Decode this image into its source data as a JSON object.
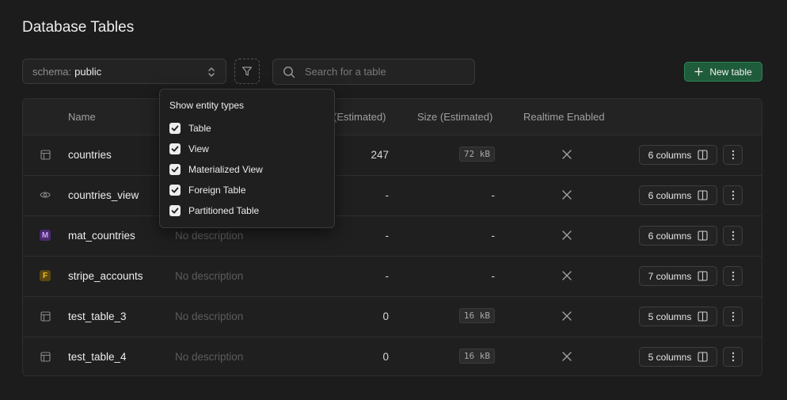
{
  "page": {
    "title": "Database Tables"
  },
  "toolbar": {
    "schema_label": "schema:",
    "schema_value": "public",
    "search_placeholder": "Search for a table",
    "new_table_label": "New table"
  },
  "table": {
    "columns": [
      "Name",
      "(Estimated)",
      "Size (Estimated)",
      "Realtime Enabled"
    ],
    "rows": [
      {
        "icon": "table-icon",
        "name": "countries",
        "description": "",
        "rows": "247",
        "size": "72 kB",
        "realtime": "disabled",
        "columns_label": "6 columns"
      },
      {
        "icon": "view-eye-icon",
        "name": "countries_view",
        "description": "",
        "rows": "-",
        "size": "-",
        "realtime": "disabled",
        "columns_label": "6 columns"
      },
      {
        "icon": "materialized-view-icon",
        "badge": "M",
        "name": "mat_countries",
        "description": "No description",
        "rows": "-",
        "size": "-",
        "realtime": "disabled",
        "columns_label": "6 columns"
      },
      {
        "icon": "foreign-table-icon",
        "badge": "F",
        "name": "stripe_accounts",
        "description": "No description",
        "rows": "-",
        "size": "-",
        "realtime": "disabled",
        "columns_label": "7 columns"
      },
      {
        "icon": "table-icon",
        "name": "test_table_3",
        "description": "No description",
        "rows": "0",
        "size": "16 kB",
        "realtime": "disabled",
        "columns_label": "5 columns"
      },
      {
        "icon": "table-icon",
        "name": "test_table_4",
        "description": "No description",
        "rows": "0",
        "size": "16 kB",
        "realtime": "disabled",
        "columns_label": "5 columns"
      }
    ]
  },
  "filter_dropdown": {
    "title": "Show entity types",
    "options": [
      {
        "label": "Table",
        "checked": true
      },
      {
        "label": "View",
        "checked": true
      },
      {
        "label": "Materialized View",
        "checked": true
      },
      {
        "label": "Foreign Table",
        "checked": true
      },
      {
        "label": "Partitioned Table",
        "checked": true
      }
    ]
  },
  "colors": {
    "background": "#1c1c1c",
    "accent_green": "#1f5c3b",
    "badge_m": "#4b2a6e",
    "badge_f": "#5a4612"
  }
}
